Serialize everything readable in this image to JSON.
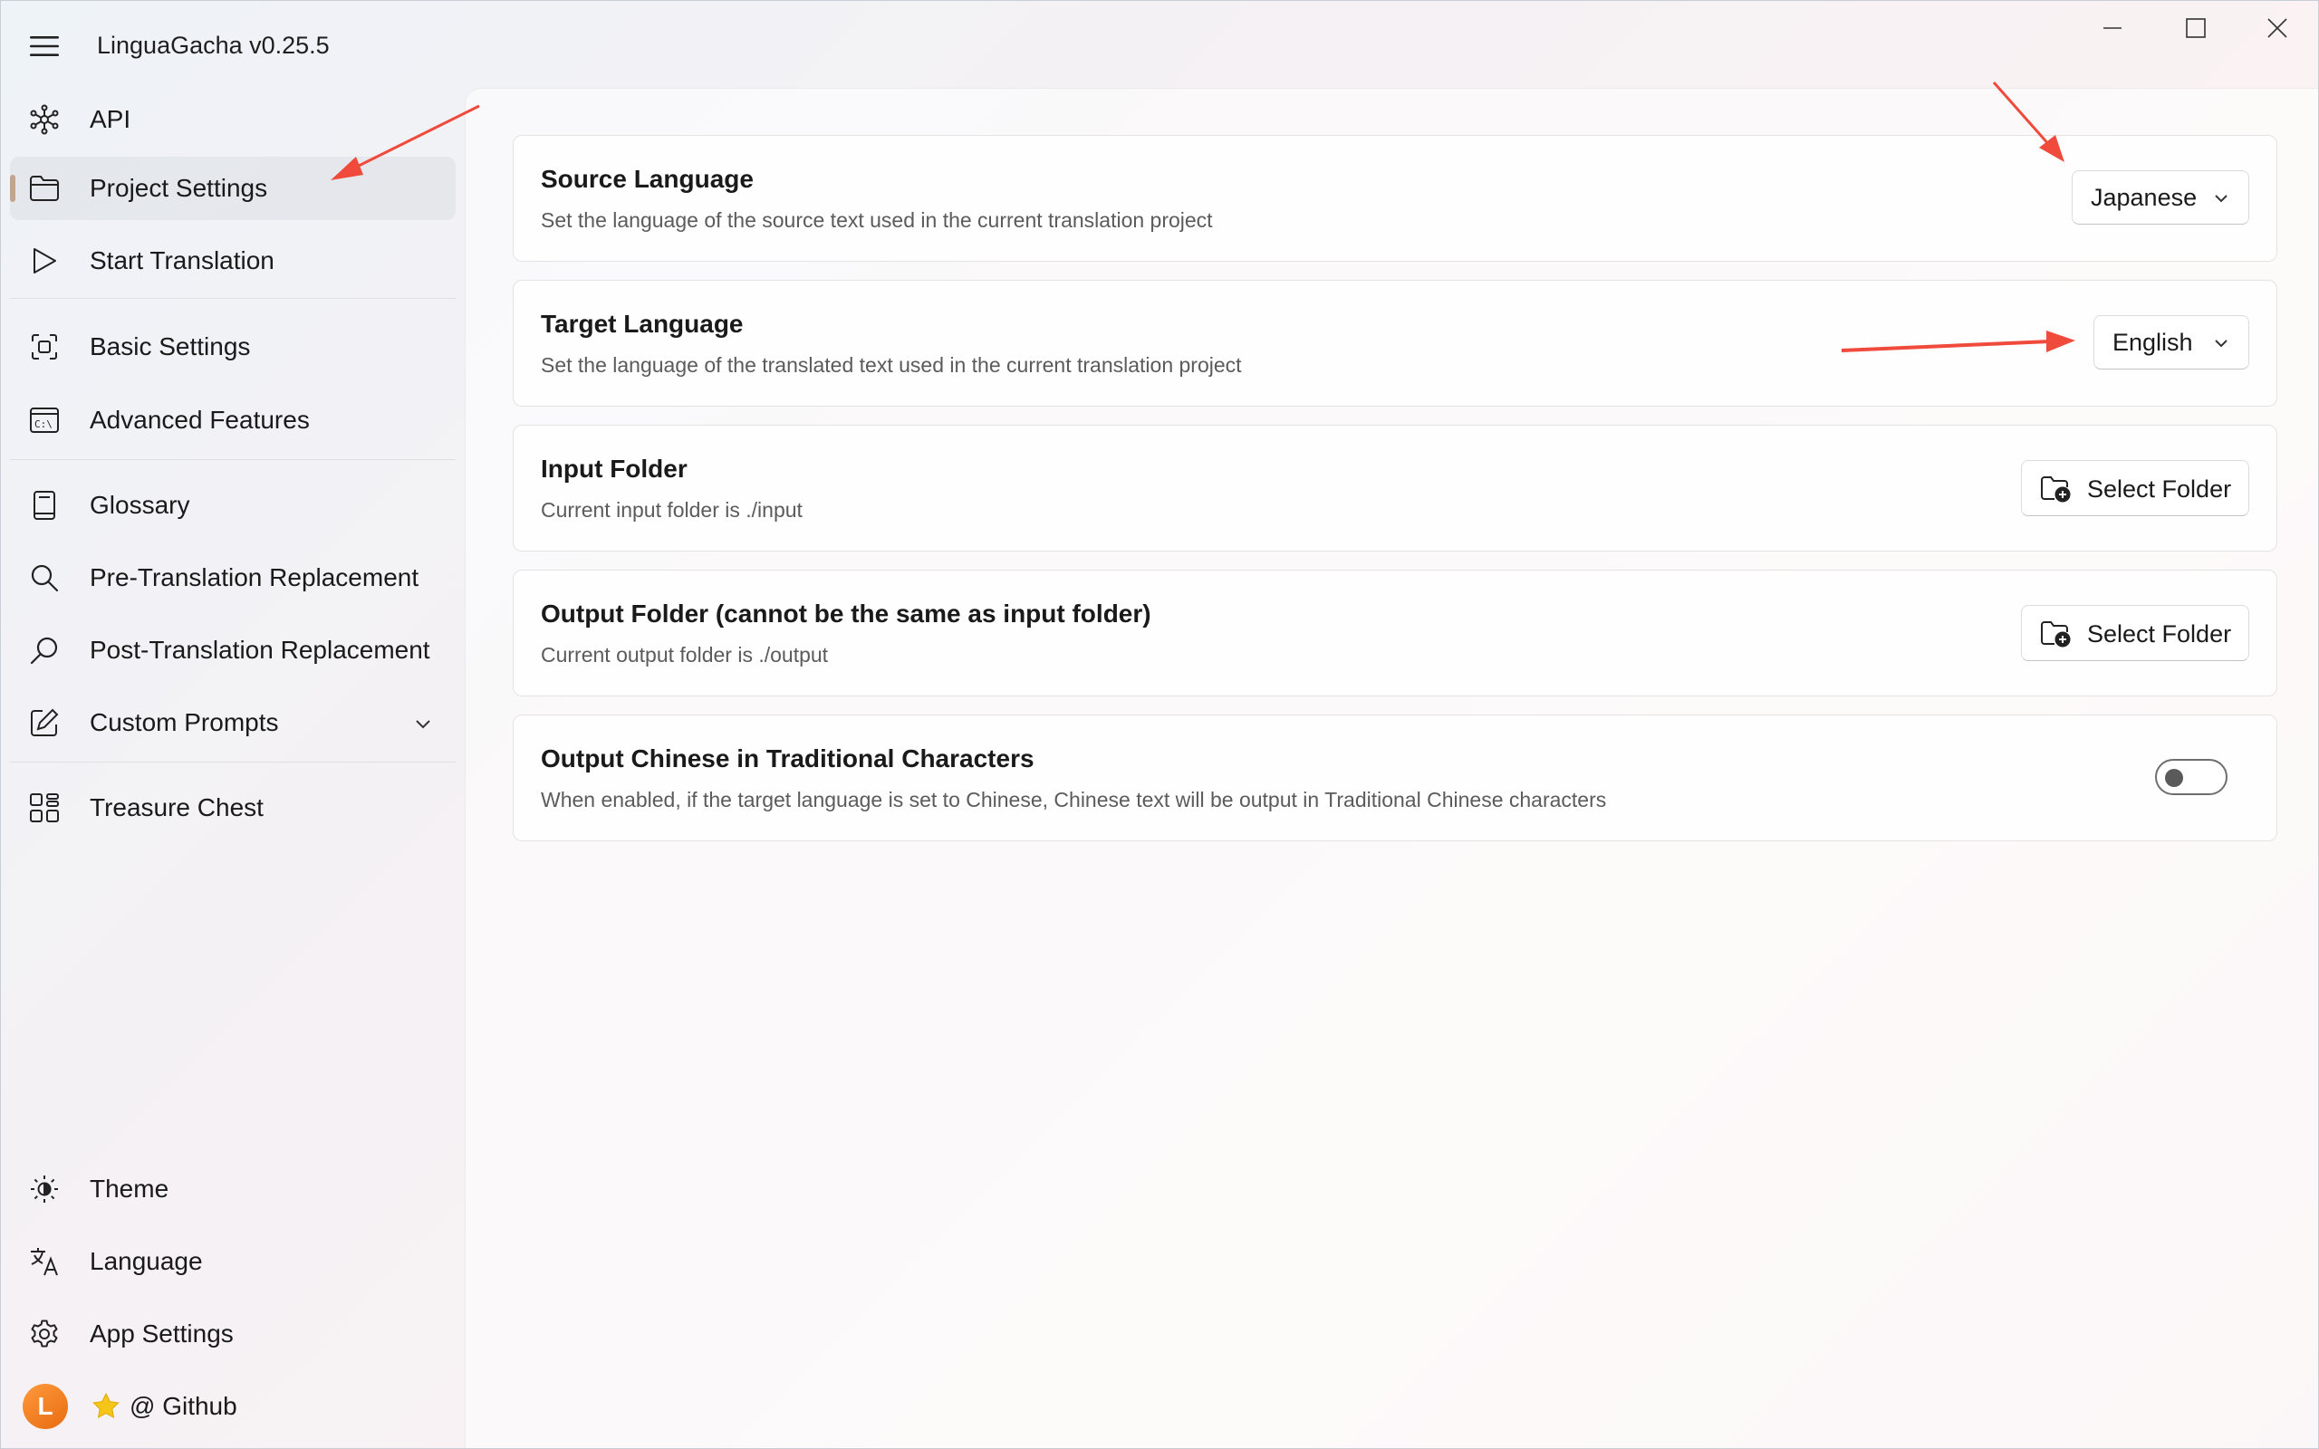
{
  "app": {
    "title": "LinguaGacha v0.25.5"
  },
  "window_controls": {
    "minimize_icon": "minimize-icon",
    "maximize_icon": "maximize-icon",
    "close_icon": "close-icon"
  },
  "sidebar": {
    "items": [
      {
        "label": "API",
        "icon": "api-network-icon"
      },
      {
        "label": "Project Settings",
        "icon": "folder-icon",
        "active": true
      },
      {
        "label": "Start Translation",
        "icon": "play-icon"
      },
      {
        "label": "Basic Settings",
        "icon": "basic-settings-icon"
      },
      {
        "label": "Advanced Features",
        "icon": "terminal-icon"
      },
      {
        "label": "Glossary",
        "icon": "book-icon"
      },
      {
        "label": "Pre-Translation Replacement",
        "icon": "search-icon"
      },
      {
        "label": "Post-Translation Replacement",
        "icon": "search-alt-icon"
      },
      {
        "label": "Custom Prompts",
        "icon": "edit-icon"
      },
      {
        "label": "Treasure Chest",
        "icon": "apps-grid-icon"
      }
    ],
    "bottom_items": [
      {
        "label": "Theme",
        "icon": "brightness-icon"
      },
      {
        "label": "Language",
        "icon": "language-icon"
      },
      {
        "label": "App Settings",
        "icon": "gear-icon"
      }
    ],
    "footer": {
      "avatar_letter": "L",
      "github_label": "@ Github",
      "star_icon": "star-icon"
    }
  },
  "settings": {
    "source_language": {
      "title": "Source Language",
      "description": "Set the language of the source text used in the current translation project",
      "value": "Japanese"
    },
    "target_language": {
      "title": "Target Language",
      "description": "Set the language of the translated text used in the current translation project",
      "value": "English"
    },
    "input_folder": {
      "title": "Input Folder",
      "description": "Current input folder is ./input",
      "button": "Select Folder"
    },
    "output_folder": {
      "title": "Output Folder (cannot be the same as input folder)",
      "description": "Current output folder is ./output",
      "button": "Select Folder"
    },
    "traditional_chinese": {
      "title": "Output Chinese in Traditional Characters",
      "description": "When enabled, if the target language is set to Chinese, Chinese text will be output in Traditional Chinese characters",
      "enabled": false
    }
  },
  "colors": {
    "annotation_arrow": "#ef4a3c",
    "active_indicator": "#c2a58b",
    "avatar": "#f08a24"
  }
}
